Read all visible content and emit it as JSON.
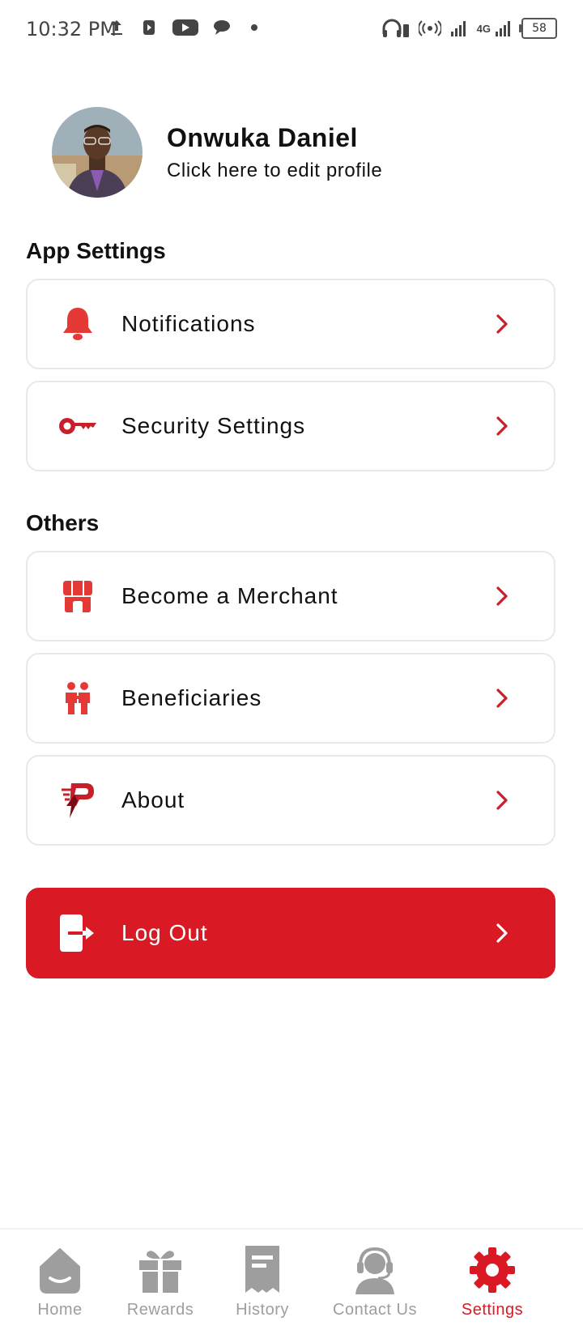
{
  "status_bar": {
    "time": "10:32 PM",
    "battery": "58",
    "network": "4G",
    "icons": [
      "upload-icon",
      "youtube-icon",
      "message-icon",
      "dot-icon",
      "headphones-icon",
      "hotspot-icon",
      "signal-icon"
    ]
  },
  "profile": {
    "name": "Onwuka Daniel",
    "subtitle": "Click here to edit profile"
  },
  "sections": {
    "app_settings": "App Settings",
    "others": "Others"
  },
  "app_settings_items": [
    {
      "label": "Notifications",
      "icon": "bell-icon"
    },
    {
      "label": "Security Settings",
      "icon": "key-icon"
    }
  ],
  "others_items": [
    {
      "label": "Become a Merchant",
      "icon": "store-icon"
    },
    {
      "label": "Beneficiaries",
      "icon": "people-icon"
    },
    {
      "label": "About",
      "icon": "brand-logo-icon"
    }
  ],
  "logout": {
    "label": "Log Out",
    "icon": "exit-icon"
  },
  "bottom_nav": [
    {
      "label": "Home",
      "icon": "home-icon",
      "active": false
    },
    {
      "label": "Rewards",
      "icon": "gift-icon",
      "active": false
    },
    {
      "label": "History",
      "icon": "receipt-icon",
      "active": false
    },
    {
      "label": "Contact Us",
      "icon": "headset-icon",
      "active": false
    },
    {
      "label": "Settings",
      "icon": "gear-icon",
      "active": true
    }
  ],
  "colors": {
    "accent": "#d91923",
    "inactive": "#9e9e9e",
    "border": "#e9e9e9"
  }
}
